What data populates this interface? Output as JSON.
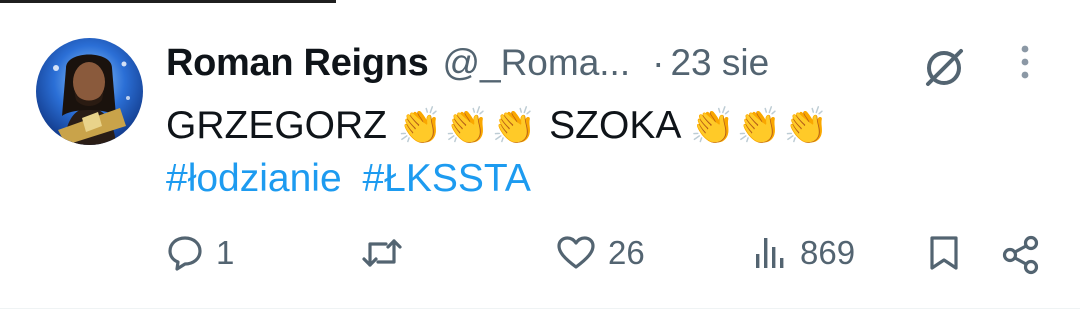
{
  "author": {
    "name": "Roman Reigns",
    "handle": "@_Roma...",
    "separator": "·",
    "time": "23 sie"
  },
  "post": {
    "segments": [
      {
        "type": "text",
        "value": "GRZEGORZ "
      },
      {
        "type": "emoji",
        "value": "👏👏👏"
      },
      {
        "type": "text",
        "value": " SZOKA "
      },
      {
        "type": "emoji",
        "value": "👏👏👏"
      }
    ],
    "text_part1": "GRZEGORZ",
    "claps1": "👏👏👏",
    "text_part2": "SZOKA",
    "claps2": "👏👏👏",
    "hashtags": [
      "#łodzianie",
      "#ŁKSSTA"
    ]
  },
  "actions": {
    "reply": {
      "icon": "reply-icon",
      "count": "1"
    },
    "repost": {
      "icon": "repost-icon",
      "count": ""
    },
    "like": {
      "icon": "heart-icon",
      "count": "26"
    },
    "views": {
      "icon": "views-icon",
      "count": "869"
    },
    "bookmark": {
      "icon": "bookmark-icon"
    },
    "share": {
      "icon": "share-icon"
    }
  },
  "icons": {
    "grok": "grok-icon",
    "more": "more-vertical-icon"
  },
  "colors": {
    "accent": "#1d9bf0",
    "muted": "#536471",
    "text": "#0f1419"
  }
}
